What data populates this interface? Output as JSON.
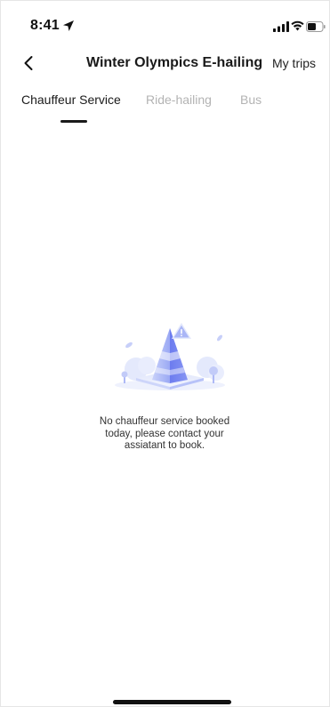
{
  "status_bar": {
    "time": "8:41",
    "location_icon": "location-arrow-icon",
    "signal_icon": "cellular-signal-icon",
    "wifi_icon": "wifi-icon",
    "battery_icon": "battery-icon"
  },
  "nav": {
    "back_icon": "chevron-left-icon",
    "title": "Winter Olympics E-hailing",
    "my_trips_label": "My trips"
  },
  "tabs": [
    {
      "label": "Chauffeur Service",
      "active": true
    },
    {
      "label": "Ride-hailing",
      "active": false
    },
    {
      "label": "Bus",
      "active": false
    }
  ],
  "empty_state": {
    "illustration_icon": "traffic-cone-warning-icon",
    "message_lines": [
      "No chauffeur service booked",
      "today, please contact your",
      "assiatant to book."
    ]
  },
  "colors": {
    "active_tab": "#1a1a1a",
    "inactive_tab": "#b3b3b3",
    "illustration_primary": "#7d8cf2",
    "illustration_light": "#dfe5fb"
  }
}
